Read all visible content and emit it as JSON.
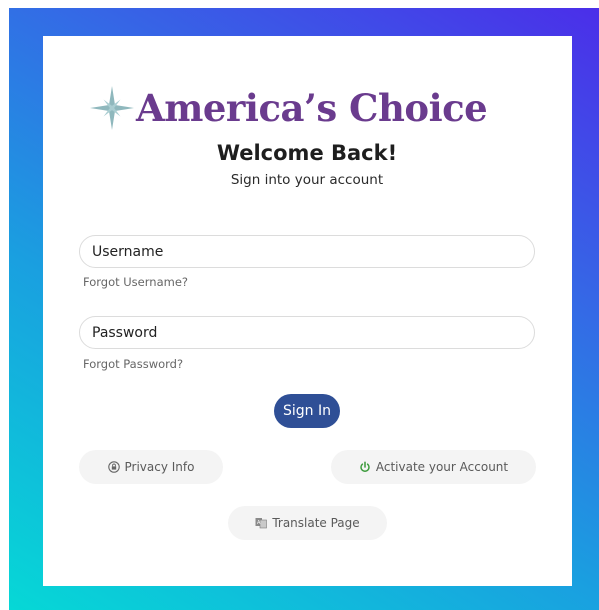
{
  "brand": {
    "name": "America’s Choice",
    "logo_icon": "four-point-star-icon",
    "logo_color": "#6a3b8e",
    "star_color": "#8fb8bd"
  },
  "header": {
    "title": "Welcome Back!",
    "subtitle": "Sign into your account"
  },
  "form": {
    "username_placeholder": "Username",
    "username_value": "",
    "forgot_username": "Forgot Username?",
    "password_placeholder": "Password",
    "password_value": "",
    "forgot_password": "Forgot Password?",
    "signin_label": "Sign In"
  },
  "links": {
    "privacy": {
      "label": "Privacy Info",
      "icon": "lock-icon"
    },
    "activate": {
      "label": "Activate your Account",
      "icon": "power-icon",
      "icon_color": "#3a9a3a"
    },
    "translate": {
      "label": "Translate Page",
      "icon": "translate-icon"
    }
  },
  "colors": {
    "gradient_start": "#06d8d6",
    "gradient_end": "#4b2ee9",
    "primary_button": "#2f4f96"
  }
}
